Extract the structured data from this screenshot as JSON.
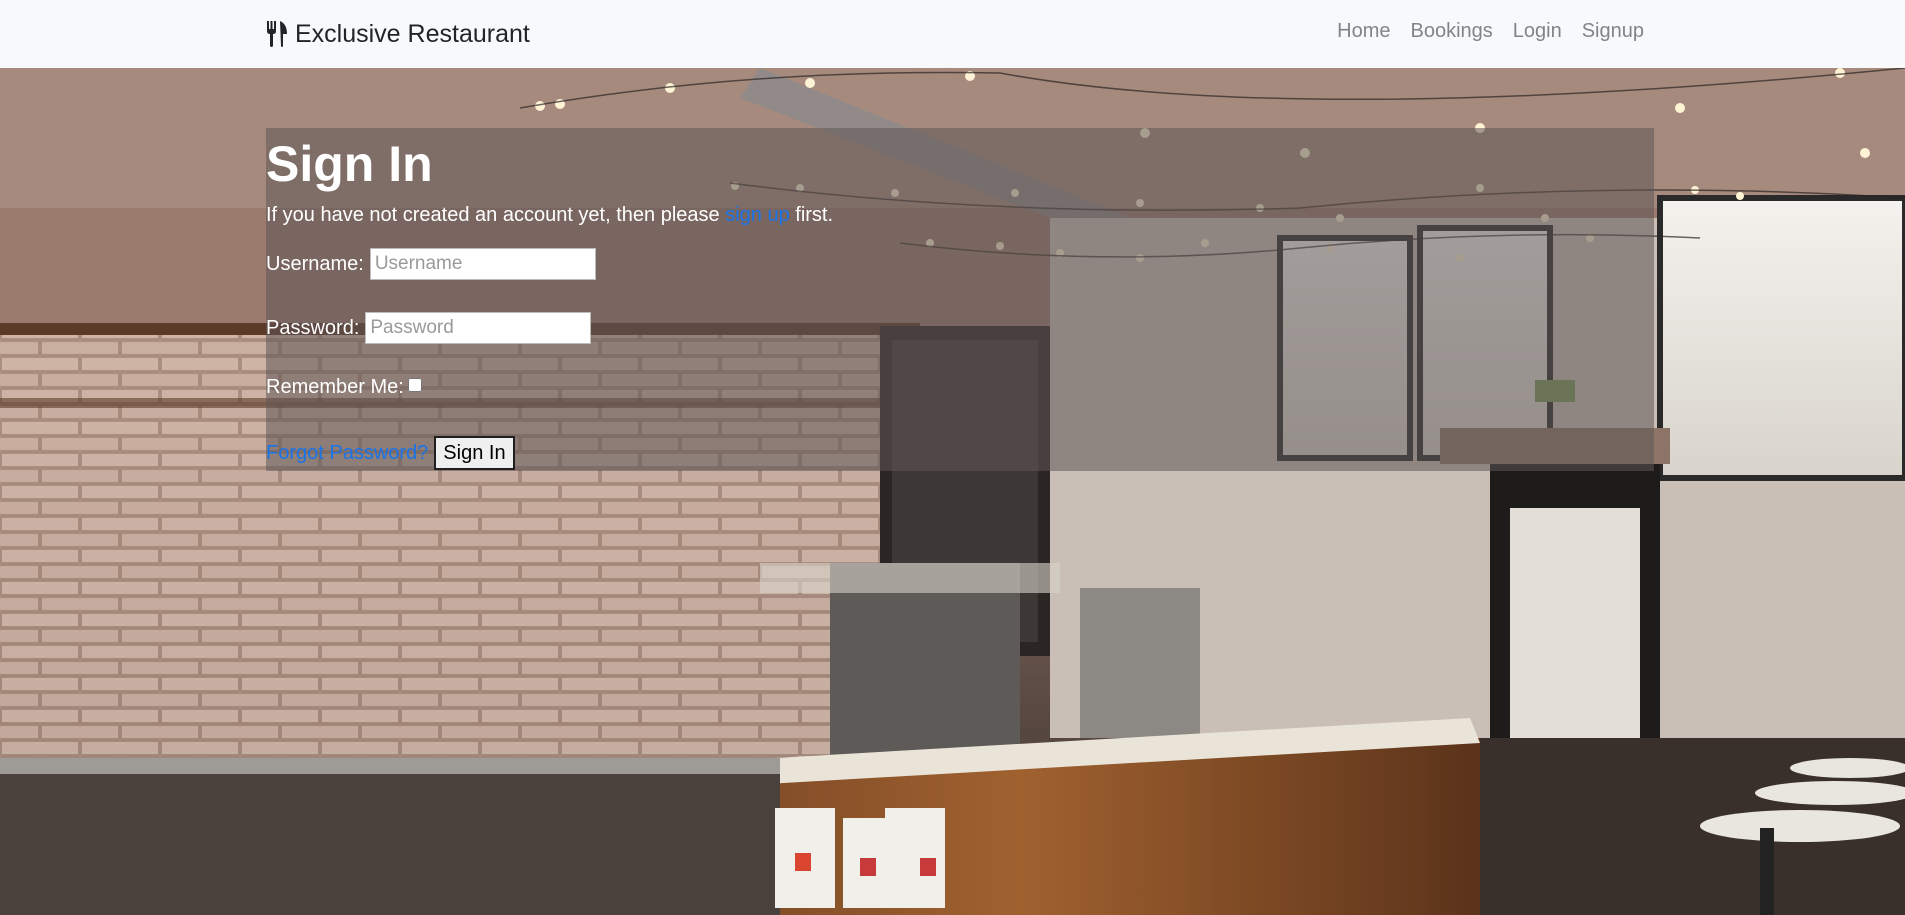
{
  "navbar": {
    "brand": "Exclusive Restaurant",
    "brand_icon": "utensils-icon",
    "links": [
      "Home",
      "Bookings",
      "Login",
      "Signup"
    ]
  },
  "signin": {
    "title": "Sign In",
    "intro_before": "If you have not created an account yet, then please ",
    "intro_link": "sign up",
    "intro_after": " first.",
    "username_label": "Username:",
    "username_placeholder": "Username",
    "username_value": "",
    "password_label": "Password:",
    "password_placeholder": "Password",
    "password_value": "",
    "remember_label": "Remember Me:",
    "remember_checked": false,
    "forgot_link": "Forgot Password?",
    "submit_label": "Sign In"
  },
  "background": {
    "image": "restaurant-interior-photo"
  },
  "colors": {
    "navbar_bg": "#f8f9fa",
    "nav_link": "#808589",
    "link_blue": "#1a73e8",
    "panel_overlay": "rgba(95,85,85,0.55)"
  }
}
